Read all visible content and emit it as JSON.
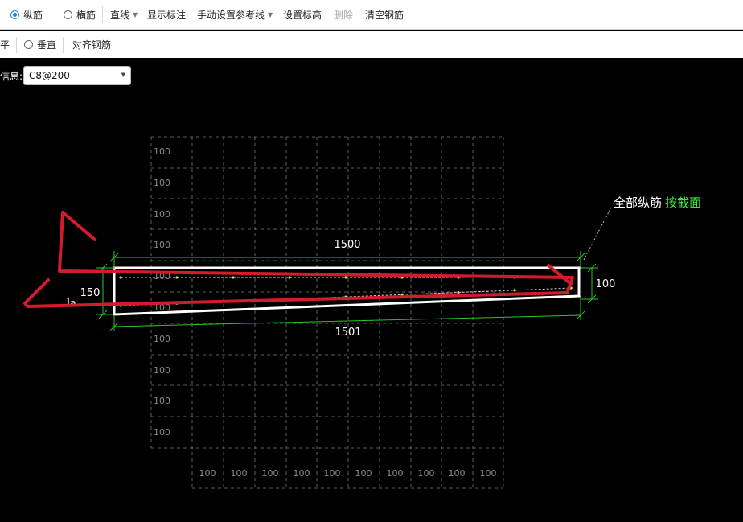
{
  "toolbar": {
    "longitudinal_label": "纵筋",
    "transverse_label": "横筋",
    "line_label": "直线",
    "show_annotation_label": "显示标注",
    "manual_ref_line_label": "手动设置参考线",
    "set_elevation_label": "设置标高",
    "delete_label": "删除",
    "clear_rebar_label": "清空钢筋"
  },
  "toolbar2": {
    "cut_text": "平",
    "vertical_label": "垂直",
    "align_rebar_label": "对齐钢筋"
  },
  "info": {
    "label": "信息:",
    "rebar_value": "C8@200"
  },
  "drawing": {
    "grid_spacing_label": "100",
    "top_dimension": "1500",
    "bottom_dimension": "1501",
    "left_dimension": "150",
    "right_dimension": "100",
    "la_label": "la",
    "callout_text": "全部纵筋",
    "callout_highlight": "按截面"
  },
  "colors": {
    "grid": "#7a7a7a",
    "dimension": "#2ec42e",
    "slab_outline": "#ffffff",
    "annotation_red": "#d21c2c",
    "highlight_green": "#39e639",
    "radio_accent": "#2a7fd4"
  }
}
